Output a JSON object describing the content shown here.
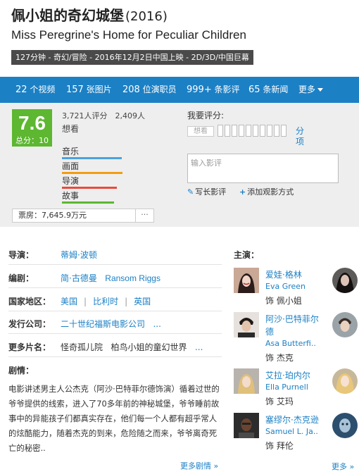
{
  "movie": {
    "cn_title": "佩小姐的奇幻城堡",
    "year": "(2016)",
    "en_title": "Miss Peregrine's Home for Peculiar Children",
    "info": "127分钟 - 奇幻/冒险 - 2016年12月2日中国上映 - 2D/3D/中国巨幕"
  },
  "nav": {
    "videos_num": "22",
    "videos_label": "个视频",
    "photos_num": "157",
    "photos_label": "张图片",
    "cast_num": "208",
    "cast_label": "位演职员",
    "reviews_num": "999+",
    "reviews_label": "条影评",
    "news_num": "65",
    "news_label": "条新闻",
    "more": "更多"
  },
  "rating": {
    "score": "7.6",
    "total": "总分：10",
    "counts": "3,721人评分　2,409人",
    "wish": "想看",
    "metrics": [
      {
        "label": "音乐",
        "fill": 0.85,
        "color": "#4aa3df"
      },
      {
        "label": "画面",
        "fill": 0.86,
        "color": "#f39c12"
      },
      {
        "label": "导演",
        "fill": 0.78,
        "color": "#e74c3c"
      },
      {
        "label": "故事",
        "fill": 0.74,
        "color": "#5db730"
      }
    ],
    "box_office": "票房：7,645.9万元",
    "box_more": "···",
    "my_rating_label": "我要评分:",
    "chip": "想看",
    "fen": "分项",
    "review_placeholder": "输入影评",
    "write_review": "写长影评",
    "add_method": "添加观影方式"
  },
  "details": {
    "director_label": "导演：",
    "director": "蒂姆·波顿",
    "writer_label": "编剧：",
    "writer1": "简·古德曼",
    "writer2": "Ransom Riggs",
    "region_label": "国家地区：",
    "region1": "美国",
    "region2": "比利时",
    "region3": "英国",
    "company_label": "发行公司：",
    "company": "二十世纪福斯电影公司",
    "aka_label": "更多片名：",
    "aka1": "怪奇孤儿院",
    "aka2": "柏鸟小姐的童幻世界",
    "ellipsis": "...",
    "plot_label": "剧情：",
    "plot": "电影讲述男主人公杰克（阿沙·巴特菲尔德饰演）循着过世的爷爷提供的线索，进入了70多年前的神秘城堡，爷爷睡前故事中的异能孩子们都真实存在，他们每一个人都有超乎常人的炫酷能力，随着杰克的到来，危险随之而来，爷爷离奇死亡的秘密..",
    "more_plot": "更多剧情 »"
  },
  "cast": {
    "title": "主演：",
    "actors": [
      {
        "name": "爱娃·格林",
        "en": "Eva Green",
        "role": "饰 佩小姐"
      },
      {
        "name": "阿沙·巴特菲尔",
        "name2": "德",
        "en": "Asa Butterfi..",
        "role": "饰 杰克"
      },
      {
        "name": "艾拉·珀内尔",
        "en": "Ella Purnell",
        "role": "饰 艾玛"
      },
      {
        "name": "塞缪尔·杰克逊",
        "en": "Samuel L. Ja..",
        "role": "饰 拜伦"
      }
    ],
    "more": "更多 »"
  }
}
